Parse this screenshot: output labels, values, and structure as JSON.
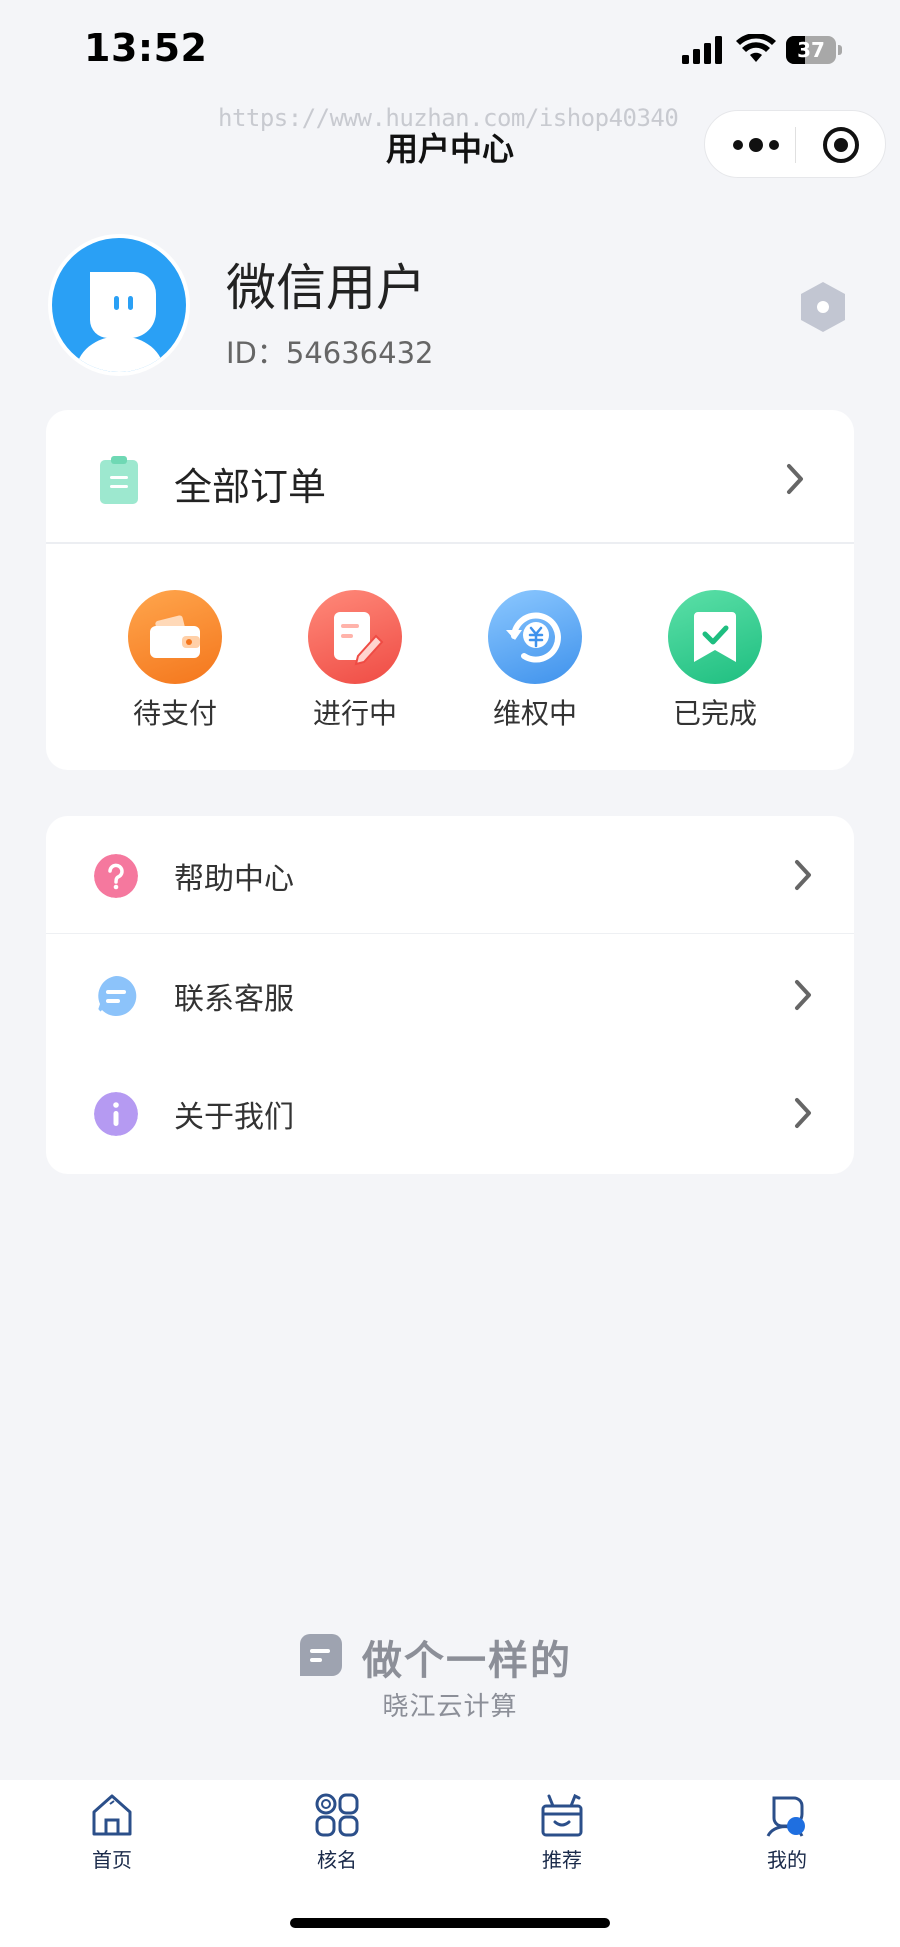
{
  "status_bar": {
    "time": "13:52",
    "battery": "37",
    "battery_level": 0.37
  },
  "nav": {
    "watermark": "https://www.huzhan.com/ishop40340",
    "title": "用户中心"
  },
  "profile": {
    "name": "微信用户",
    "id_text": "ID：54636432"
  },
  "orders": {
    "title": "全部订单",
    "statuses": [
      {
        "label": "待支付",
        "icon": "wallet-icon",
        "color": "#fb8a2c"
      },
      {
        "label": "进行中",
        "icon": "edit-document-icon",
        "color": "#f65a4f"
      },
      {
        "label": "维权中",
        "icon": "refund-icon",
        "color": "#4a9df2"
      },
      {
        "label": "已完成",
        "icon": "completed-bookmark-icon",
        "color": "#27c98a"
      }
    ]
  },
  "menu": [
    {
      "label": "帮助中心",
      "icon": "help-icon",
      "color": "#f5789e"
    },
    {
      "label": "联系客服",
      "icon": "chat-icon",
      "color": "#8cc3fa"
    },
    {
      "label": "关于我们",
      "icon": "info-icon",
      "color": "#b59af2"
    }
  ],
  "brand": {
    "main": "做个一样的",
    "sub": "晓江云计算"
  },
  "tabbar": [
    {
      "label": "首页",
      "icon": "home-icon"
    },
    {
      "label": "核名",
      "icon": "grid-icon"
    },
    {
      "label": "推荐",
      "icon": "gift-box-icon"
    },
    {
      "label": "我的",
      "icon": "profile-icon"
    }
  ]
}
